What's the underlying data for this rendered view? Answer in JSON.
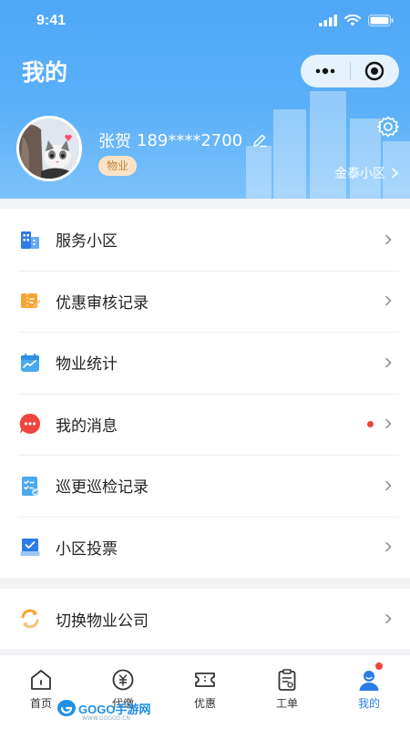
{
  "status_bar": {
    "time": "9:41"
  },
  "header": {
    "title": "我的",
    "user_name": "张贺",
    "phone": "189****2700",
    "role": "物业",
    "community": "金泰小区",
    "bg_color": "#4ea7f7"
  },
  "menu": {
    "items": [
      {
        "label": "服务小区",
        "icon": "building-icon"
      },
      {
        "label": "优惠审核记录",
        "icon": "coupon-review-icon"
      },
      {
        "label": "物业统计",
        "icon": "statistics-icon"
      },
      {
        "label": "我的消息",
        "icon": "message-icon",
        "has_unread": true
      },
      {
        "label": "巡更巡检记录",
        "icon": "patrol-checklist-icon"
      },
      {
        "label": "小区投票",
        "icon": "vote-icon"
      }
    ],
    "switch_company": {
      "label": "切换物业公司",
      "icon": "switch-icon"
    }
  },
  "tabbar": {
    "tabs": [
      {
        "label": "首页",
        "icon": "home-icon"
      },
      {
        "label": "代缴",
        "icon": "payment-icon"
      },
      {
        "label": "优惠",
        "icon": "ticket-icon"
      },
      {
        "label": "工单",
        "icon": "work-order-icon"
      },
      {
        "label": "我的",
        "icon": "profile-icon",
        "active": true
      }
    ],
    "active_color": "#2b7de9"
  },
  "watermark": {
    "brand": "GOGO手游网",
    "url": "WWW.GOGOD.CN"
  }
}
